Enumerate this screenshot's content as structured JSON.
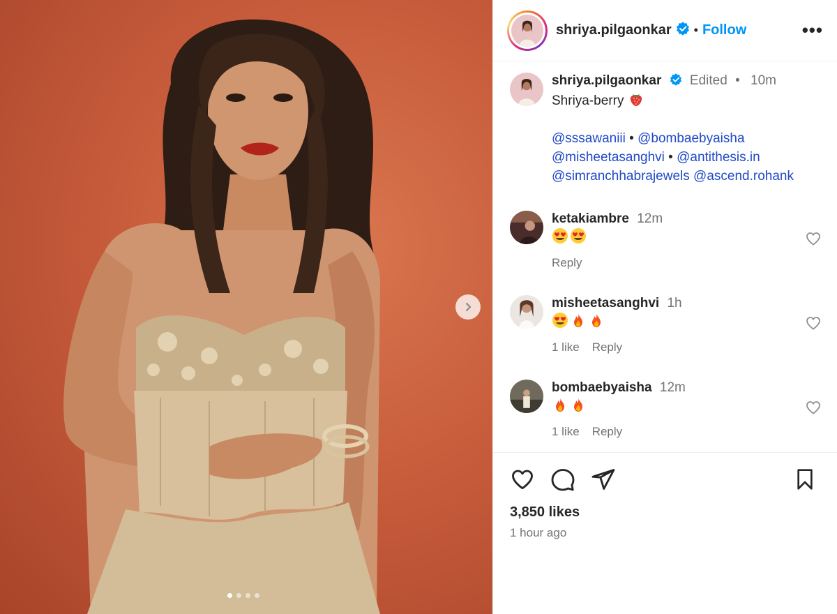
{
  "header": {
    "username": "shriya.pilgaonkar",
    "separator": "•",
    "follow_label": "Follow",
    "more_label": "•••"
  },
  "caption": {
    "username": "shriya.pilgaonkar",
    "edited": "Edited",
    "separator": "•",
    "time": "10m",
    "text": "Shriya-berry",
    "emoji": "strawberry",
    "mentions_line1": [
      "@sssawaniii",
      "•",
      "@bombaebyaisha"
    ],
    "mentions_line2": [
      "@misheetasanghvi",
      "•",
      "@antithesis.in"
    ],
    "mentions_line3": [
      "@simranchhabrajewels",
      "@ascend.rohank"
    ]
  },
  "comments": [
    {
      "username": "ketakiambre",
      "time": "12m",
      "emojis": [
        "heart-eyes",
        "heart-eyes"
      ],
      "likes": "",
      "reply": "Reply"
    },
    {
      "username": "misheetasanghvi",
      "time": "1h",
      "emojis": [
        "heart-eyes",
        "fire",
        "fire"
      ],
      "likes": "1 like",
      "reply": "Reply"
    },
    {
      "username": "bombaebyaisha",
      "time": "12m",
      "emojis": [
        "fire",
        "fire"
      ],
      "likes": "1 like",
      "reply": "Reply"
    }
  ],
  "footer": {
    "likes": "3,850 likes",
    "time_ago": "1 hour ago"
  },
  "carousel": {
    "slides": 4,
    "active": 1
  },
  "colors": {
    "accent": "#0095f6",
    "mention": "#2049c7",
    "backdrop": "#c85d3c"
  }
}
